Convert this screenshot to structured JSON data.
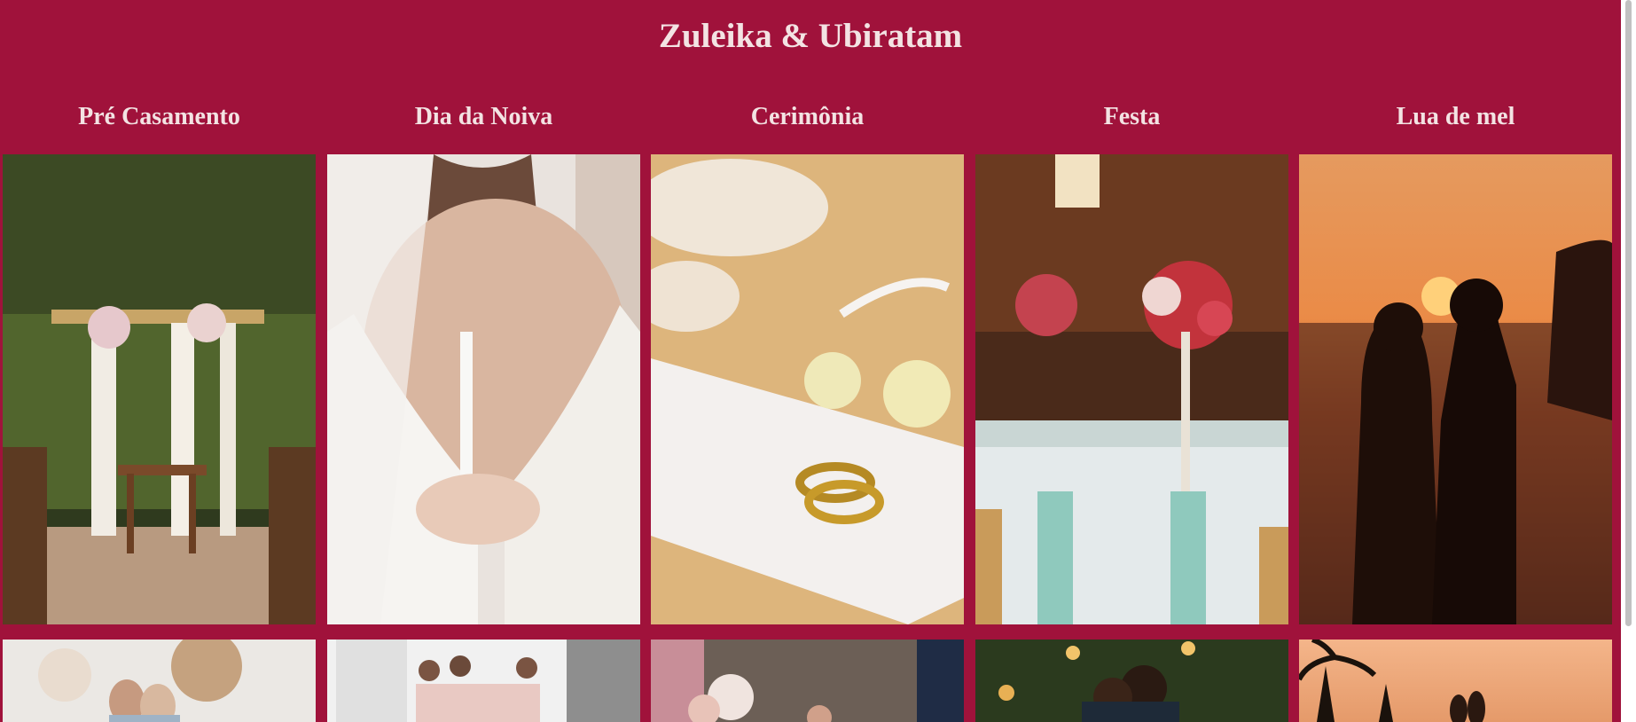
{
  "page": {
    "title": "Zuleika & Ubiratam"
  },
  "gallery": {
    "columns": [
      {
        "label": "Pré Casamento"
      },
      {
        "label": "Dia da Noiva"
      },
      {
        "label": "Cerimônia"
      },
      {
        "label": "Festa"
      },
      {
        "label": "Lua de mel"
      }
    ]
  },
  "colors": {
    "background": "#a0123b",
    "heading_text": "#f3e3e3"
  }
}
